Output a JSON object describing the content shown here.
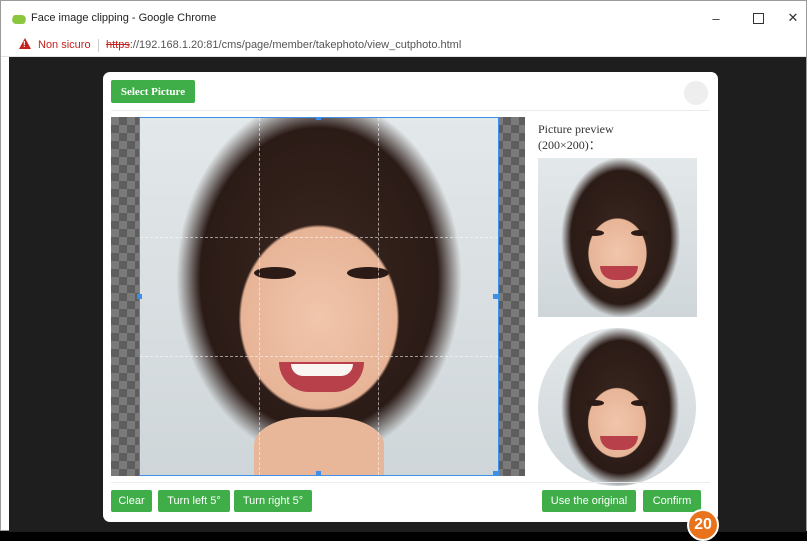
{
  "window": {
    "title": "Face image clipping - Google Chrome",
    "minimize_icon": "minimize-icon",
    "maximize_icon": "maximize-icon",
    "close_icon": "close-icon"
  },
  "addressbar": {
    "security_label": "Non sicuro",
    "url_protocol": "https",
    "url_rest": "://192.168.1.20:81/cms/page/member/takephoto/view_cutphoto.html"
  },
  "dialog": {
    "select_picture_label": "Select Picture",
    "preview_label": "Picture preview",
    "preview_size_label": "(200×200)：",
    "buttons": {
      "clear": "Clear",
      "turn_left": "Turn left 5°",
      "turn_right": "Turn right 5°",
      "use_original": "Use the original",
      "confirm": "Confirm"
    }
  },
  "step_badge": "20",
  "colors": {
    "button_green": "#3fae49",
    "crop_border": "#3d8fe8",
    "badge_orange": "#e8731c",
    "insecure_red": "#c5221f"
  }
}
